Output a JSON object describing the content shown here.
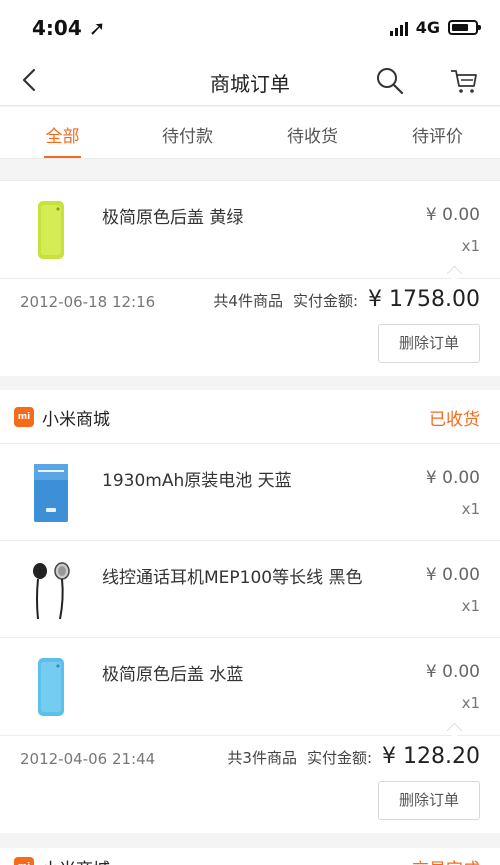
{
  "status_bar": {
    "time": "4:04 ➚",
    "network": "4G"
  },
  "nav": {
    "title": "商城订单"
  },
  "tabs": [
    {
      "label": "全部"
    },
    {
      "label": "待付款"
    },
    {
      "label": "待收货"
    },
    {
      "label": "待评价"
    }
  ],
  "orders": [
    {
      "items": [
        {
          "name": "极简原色后盖 黄绿",
          "price": "¥ 0.00",
          "qty": "x1",
          "color": "#c7e23a"
        }
      ],
      "date": "2012-06-18 12:16",
      "count": "共4件商品",
      "paid_label": "实付金额:",
      "amount": "¥ 1758.00",
      "delete_label": "删除订单"
    },
    {
      "shop_logo": "mi",
      "shop_name": "小米商城",
      "status": "已收货",
      "items": [
        {
          "name": "1930mAh原装电池 天蓝",
          "price": "¥ 0.00",
          "qty": "x1",
          "color": "#3d8fd6"
        },
        {
          "name": "线控通话耳机MEP100等长线 黑色",
          "price": "¥ 0.00",
          "qty": "x1",
          "color": "#222222"
        },
        {
          "name": "极简原色后盖 水蓝",
          "price": "¥ 0.00",
          "qty": "x1",
          "color": "#5cc0ea"
        }
      ],
      "date": "2012-04-06 21:44",
      "count": "共3件商品",
      "paid_label": "实付金额:",
      "amount": "¥ 128.20",
      "delete_label": "删除订单"
    }
  ],
  "next_order": {
    "shop_name": "小米商城",
    "status": "交易完成"
  }
}
